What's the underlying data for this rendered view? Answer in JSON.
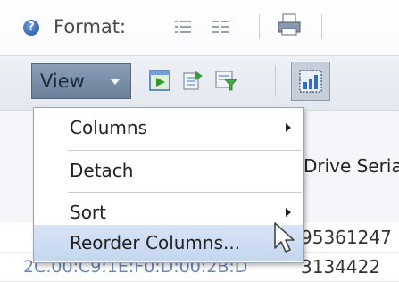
{
  "toolbar": {
    "format_label": "Format:",
    "icons": [
      "help-icon",
      "format-list-icon",
      "format-grid-icon",
      "print-icon"
    ]
  },
  "view_toolbar": {
    "view_label": "View",
    "icons": [
      "play-icon",
      "export-icon",
      "filter-icon",
      "chart-icon"
    ]
  },
  "table": {
    "visible_header": "Drive Seria",
    "rows": [
      {
        "left": "",
        "right": "95361247"
      },
      {
        "left": "2C.00:C9:1E:F0:D:00:2B:D",
        "right": "3134422"
      }
    ]
  },
  "menu": {
    "items": [
      {
        "label": "Columns",
        "submenu": true
      },
      {
        "label": "Detach",
        "submenu": false
      },
      {
        "label": "Sort",
        "submenu": true
      },
      {
        "label": "Reorder Columns...",
        "submenu": false,
        "highlighted": true
      }
    ]
  },
  "colors": {
    "view_button": "#6b7f99",
    "menu_highlight": "#c4d6f0",
    "help_icon": "#1f4fa8"
  }
}
